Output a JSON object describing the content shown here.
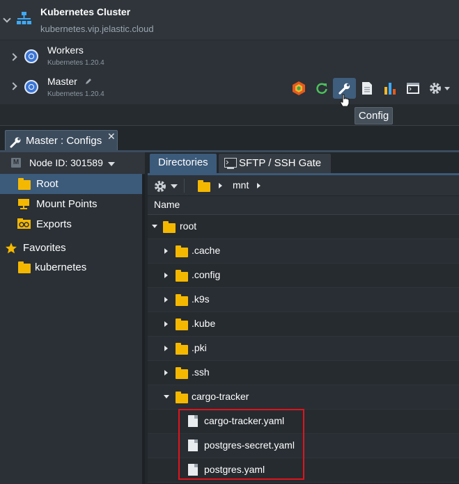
{
  "environment": {
    "title": "Kubernetes Cluster",
    "domain": "kubernetes.vip.jelastic.cloud"
  },
  "nodes": [
    {
      "name": "Workers",
      "version": "Kubernetes 1.20.4"
    },
    {
      "name": "Master",
      "version": "Kubernetes 1.20.4"
    }
  ],
  "toolbar": {
    "icons": [
      "addons-icon",
      "restart-icon",
      "config-icon",
      "log-icon",
      "statistics-icon",
      "web-ssh-icon",
      "settings-icon"
    ],
    "tooltip": "Config"
  },
  "config_panel": {
    "tab_title": "Master : Configs",
    "node_select": "Node ID: 301589",
    "sidebar": {
      "items": [
        {
          "label": "Root",
          "icon": "folder-icon",
          "selected": true
        },
        {
          "label": "Mount Points",
          "icon": "mount-point-icon"
        },
        {
          "label": "Exports",
          "icon": "exports-icon"
        }
      ],
      "favorites_label": "Favorites",
      "favorites": [
        {
          "label": "kubernetes",
          "icon": "folder-icon"
        }
      ]
    },
    "tabs": [
      {
        "label": "Directories",
        "active": true
      },
      {
        "label": "SFTP / SSH Gate",
        "active": false
      }
    ],
    "path": [
      "mnt"
    ],
    "column_header": "Name",
    "tree": [
      {
        "label": "root",
        "type": "folder",
        "expanded": true
      },
      {
        "label": ".cache",
        "type": "folder"
      },
      {
        "label": ".config",
        "type": "folder"
      },
      {
        "label": ".k9s",
        "type": "folder"
      },
      {
        "label": ".kube",
        "type": "folder"
      },
      {
        "label": ".pki",
        "type": "folder"
      },
      {
        "label": ".ssh",
        "type": "folder"
      },
      {
        "label": "cargo-tracker",
        "type": "folder",
        "expanded": true
      },
      {
        "label": "cargo-tracker.yaml",
        "type": "file"
      },
      {
        "label": "postgres-secret.yaml",
        "type": "file"
      },
      {
        "label": "postgres.yaml",
        "type": "file"
      }
    ]
  },
  "colors": {
    "accent": "#3c5a7a",
    "folder": "#f5b800",
    "highlight": "#e0141b"
  }
}
